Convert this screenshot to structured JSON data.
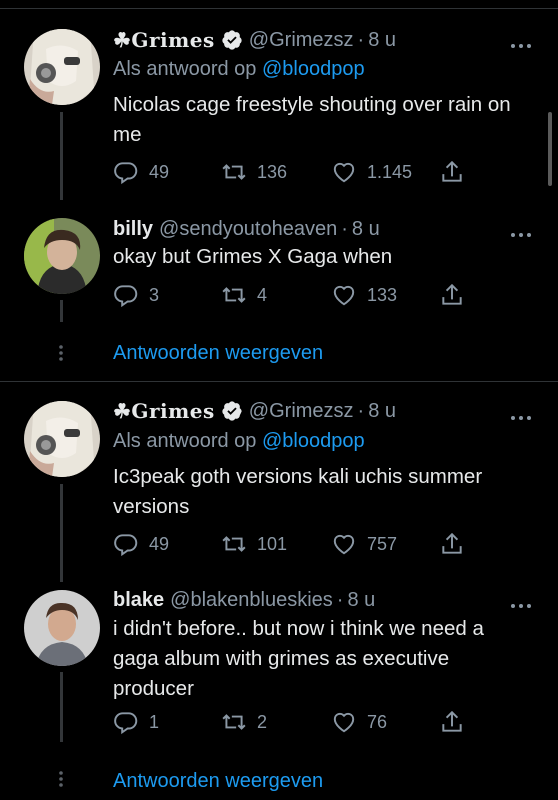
{
  "threads": [
    {
      "parent": {
        "name": "☘Grimes",
        "verified": true,
        "handle": "@Grimezsz",
        "dot": "·",
        "time": "8 u",
        "reply_prefix": "Als antwoord op",
        "reply_mention": "@bloodpop",
        "text": "Nicolas cage freestyle shouting over rain on me",
        "replies": "49",
        "retweets": "136",
        "likes": "1.145"
      },
      "reply": {
        "name": "billy",
        "handle": "@sendyoutoheaven",
        "dot": "·",
        "time": "8 u",
        "text": "okay but Grimes X Gaga when",
        "replies": "3",
        "retweets": "4",
        "likes": "133"
      },
      "show_replies": "Antwoorden weergeven"
    },
    {
      "parent": {
        "name": "☘Grimes",
        "verified": true,
        "handle": "@Grimezsz",
        "dot": "·",
        "time": "8 u",
        "reply_prefix": "Als antwoord op",
        "reply_mention": "@bloodpop",
        "text": "Ic3peak goth versions kali uchis summer versions",
        "replies": "49",
        "retweets": "101",
        "likes": "757"
      },
      "reply": {
        "name": "blake",
        "handle": "@blakenblueskies",
        "dot": "·",
        "time": "8 u",
        "text": "i didn't before.. but now i think we need a gaga album with grimes as executive producer",
        "replies": "1",
        "retweets": "2",
        "likes": "76"
      },
      "show_replies": "Antwoorden weergeven"
    }
  ],
  "icons": {
    "reply": "reply-icon",
    "retweet": "retweet-icon",
    "like": "heart-icon",
    "share": "share-icon",
    "verified": "verified-badge-icon",
    "more": "more-options-icon"
  },
  "colors": {
    "background": "#000000",
    "text": "#e7e9ea",
    "muted": "#8b98a5",
    "link": "#1d9bf0",
    "verified": "#e7e9ea",
    "divider": "#2f3336"
  }
}
